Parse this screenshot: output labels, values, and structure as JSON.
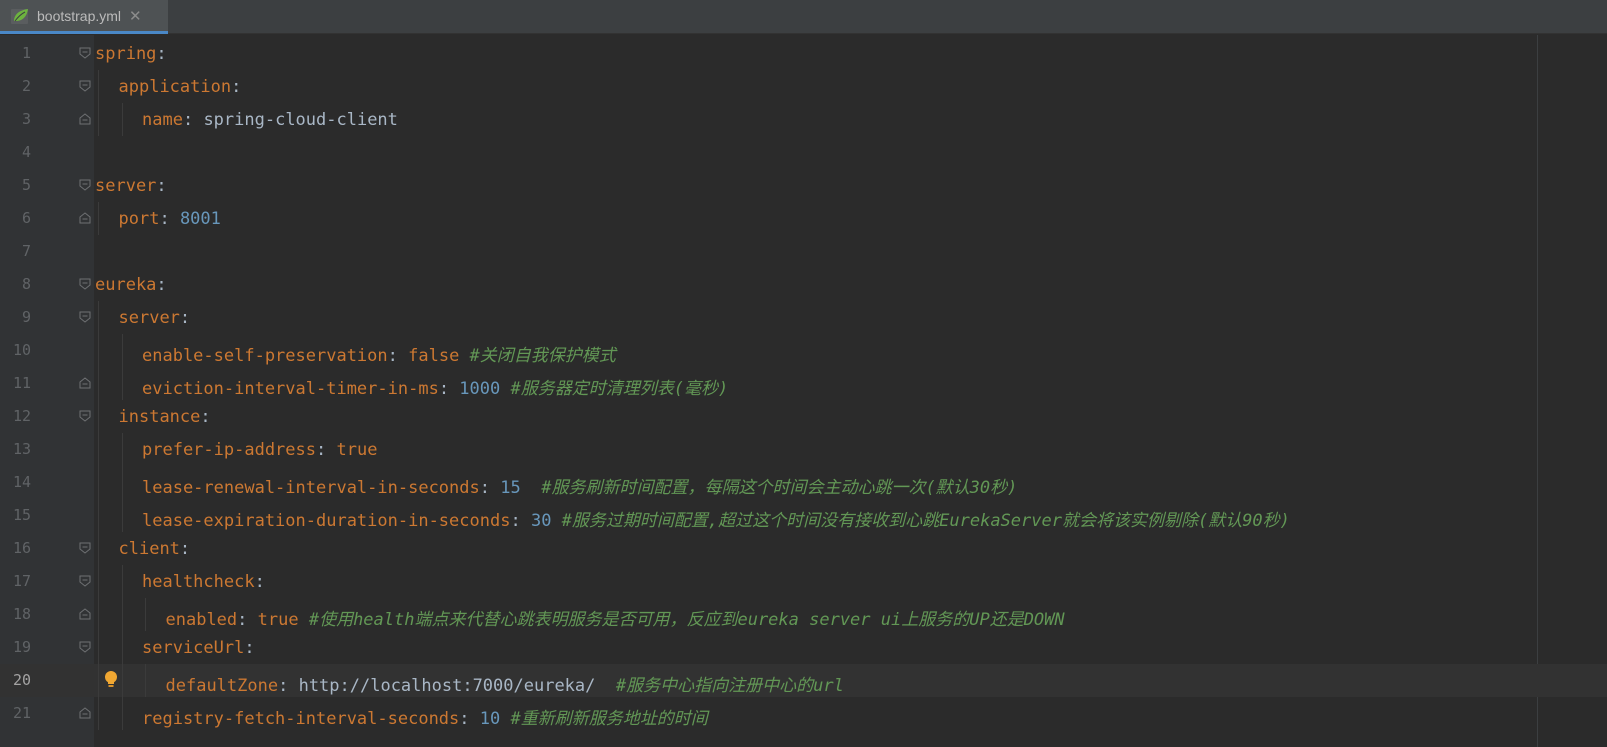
{
  "tab": {
    "filename": "bootstrap.yml",
    "close": "✕",
    "icon": "spring-leaf-icon"
  },
  "colors": {
    "key": "#cc7832",
    "number": "#6897bb",
    "comment": "#629755",
    "text": "#a9b7c6"
  },
  "current_line": 20,
  "lines": [
    {
      "n": "1",
      "key": "spring",
      "sep": ":"
    },
    {
      "n": "2",
      "key": "application",
      "sep": ":"
    },
    {
      "n": "3",
      "key": "name",
      "sep": ": ",
      "value": "spring-cloud-client"
    },
    {
      "n": "4"
    },
    {
      "n": "5",
      "key": "server",
      "sep": ":"
    },
    {
      "n": "6",
      "key": "port",
      "sep": ": ",
      "num": "8001"
    },
    {
      "n": "7"
    },
    {
      "n": "8",
      "key": "eureka",
      "sep": ":"
    },
    {
      "n": "9",
      "key": "server",
      "sep": ":"
    },
    {
      "n": "10",
      "key": "enable-self-preservation",
      "sep": ": ",
      "kw": "false",
      "comment": " #关闭自我保护模式"
    },
    {
      "n": "11",
      "key": "eviction-interval-timer-in-ms",
      "sep": ": ",
      "num": "1000",
      "comment": " #服务器定时清理列表(毫秒)"
    },
    {
      "n": "12",
      "key": "instance",
      "sep": ":"
    },
    {
      "n": "13",
      "key": "prefer-ip-address",
      "sep": ": ",
      "kw": "true"
    },
    {
      "n": "14",
      "key": "lease-renewal-interval-in-seconds",
      "sep": ": ",
      "num": "15",
      "comment": "  #服务刷新时间配置，每隔这个时间会主动心跳一次(默认30秒)"
    },
    {
      "n": "15",
      "key": "lease-expiration-duration-in-seconds",
      "sep": ": ",
      "num": "30",
      "comment": " #服务过期时间配置,超过这个时间没有接收到心跳EurekaServer就会将该实例剔除(默认90秒)"
    },
    {
      "n": "16",
      "key": "client",
      "sep": ":"
    },
    {
      "n": "17",
      "key": "healthcheck",
      "sep": ":"
    },
    {
      "n": "18",
      "key": "enabled",
      "sep": ": ",
      "kw": "true",
      "comment": " #使用health端点来代替心跳表明服务是否可用，反应到eureka server ui上服务的UP还是DOWN"
    },
    {
      "n": "19",
      "key": "serviceUrl",
      "sep": ":"
    },
    {
      "n": "20",
      "key": "defaultZone",
      "sep": ": ",
      "value": "http://localhost:7000/eureka/",
      "comment": "  #服务中心指向注册中心的url"
    },
    {
      "n": "21",
      "key": "registry-fetch-interval-seconds",
      "sep": ": ",
      "num": "10",
      "comment": " #重新刷新服务地址的时间"
    }
  ]
}
